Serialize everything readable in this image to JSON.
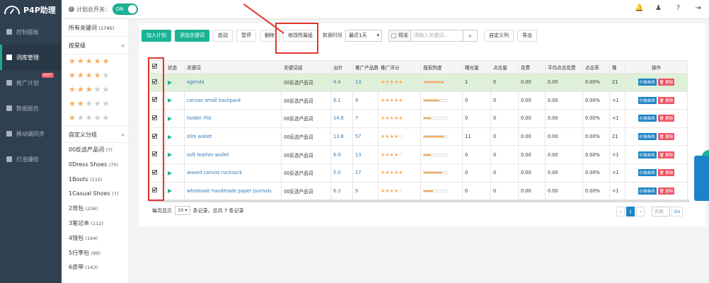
{
  "brand": {
    "name": "P4P助理"
  },
  "plan_switch": {
    "label": "计划总开关：",
    "state": "ON"
  },
  "top_icons": [
    "bell-icon",
    "user-icon",
    "help-icon",
    "logout-icon"
  ],
  "sidebar": {
    "items": [
      {
        "label": "控制面板",
        "icon": "home-icon"
      },
      {
        "label": "词库管理",
        "icon": "monitor-icon",
        "active": true
      },
      {
        "label": "推广计划",
        "icon": "tag-icon",
        "badge": "HOT"
      },
      {
        "label": "数据报告",
        "icon": "chart-icon"
      },
      {
        "label": "移动端同步",
        "icon": "mobile-icon"
      },
      {
        "label": "打造爆款",
        "icon": "card-icon"
      }
    ]
  },
  "groups": {
    "all_label": "所有关键词",
    "all_count": "(1745)",
    "by_stars_label": "按星级",
    "star_levels": [
      5,
      4,
      3,
      2,
      1
    ],
    "custom_label": "自定义分组",
    "items": [
      {
        "name": "00反选产品词",
        "count": "(7)"
      },
      {
        "name": "0Dress Shoes",
        "count": "(70)"
      },
      {
        "name": "1Boots",
        "count": "(115)"
      },
      {
        "name": "1Casual Shoes",
        "count": "(7)"
      },
      {
        "name": "2背包",
        "count": "(236)"
      },
      {
        "name": "3笔记本",
        "count": "(112)"
      },
      {
        "name": "4钱包",
        "count": "(164)"
      },
      {
        "name": "5行李包",
        "count": "(99)"
      },
      {
        "name": "6皮带",
        "count": "(143)"
      }
    ]
  },
  "toolbar": {
    "add_plan": "加入计划",
    "add_keyword": "添加关键词",
    "start": "启动",
    "pause": "暂停",
    "delete": "删除",
    "modify_group": "修改所属组",
    "data_period_label": "数据时段",
    "data_period_value": "最近1天",
    "exact_label": "精准",
    "search_placeholder": "请输入关键词...",
    "custom_columns": "自定义列",
    "export": "导出"
  },
  "table": {
    "headers": [
      "",
      "状态",
      "关键词",
      "关键词组",
      "出价",
      "推广产品数",
      "推广评分",
      "搜索热度",
      "曝光量",
      "点击量",
      "花费",
      "平均点击花费",
      "点击率",
      "推",
      "操作"
    ],
    "rows": [
      {
        "keyword": "agenda",
        "group": "00反选产品词",
        "bid": "4.4",
        "products": "13",
        "rating": 5,
        "heat": 0.9,
        "impr": "1",
        "clicks": "0",
        "cost": "0.00",
        "cpc": "0.00",
        "ctr": "0.00%",
        "rank": "21",
        "highlight": true
      },
      {
        "keyword": "canvas small backpack",
        "group": "00反选产品词",
        "bid": "8.1",
        "products": "8",
        "rating": 5,
        "heat": 0.7,
        "impr": "0",
        "clicks": "0",
        "cost": "0.00",
        "cpc": "0.00",
        "ctr": "0.00%",
        "rank": "<1"
      },
      {
        "keyword": "holder rfid",
        "group": "00反选产品词",
        "bid": "14.6",
        "products": "7",
        "rating": 5,
        "heat": 0.3,
        "impr": "0",
        "clicks": "0",
        "cost": "0.00",
        "cpc": "0.00",
        "ctr": "0.00%",
        "rank": "<1"
      },
      {
        "keyword": "slim wallet",
        "group": "00反选产品词",
        "bid": "13.8",
        "products": "57",
        "rating": 4,
        "heat": 0.9,
        "impr": "11",
        "clicks": "0",
        "cost": "0.00",
        "cpc": "0.00",
        "ctr": "0.00%",
        "rank": "21"
      },
      {
        "keyword": "soft leather wallet",
        "group": "00反选产品词",
        "bid": "6.9",
        "products": "13",
        "rating": 4,
        "heat": 0.3,
        "impr": "0",
        "clicks": "0",
        "cost": "0.00",
        "cpc": "0.00",
        "ctr": "0.00%",
        "rank": "<1"
      },
      {
        "keyword": "waxed canvas rucksack",
        "group": "00反选产品词",
        "bid": "5.0",
        "products": "17",
        "rating": 5,
        "heat": 0.8,
        "impr": "0",
        "clicks": "0",
        "cost": "0.00",
        "cpc": "0.00",
        "ctr": "0.00%",
        "rank": "<1"
      },
      {
        "keyword": "wholesale handmade paper journals",
        "group": "00反选产品词",
        "bid": "6.3",
        "products": "9",
        "rating": 4,
        "heat": 0.4,
        "impr": "0",
        "clicks": "0",
        "cost": "0.00",
        "cpc": "0.00",
        "ctr": "0.00%",
        "rank": "<1"
      }
    ],
    "actions": {
      "curve": "价格曲线",
      "delete": "删除"
    }
  },
  "footer": {
    "per_page_label": "每页显示",
    "per_page_value": "10",
    "summary": "条记录，总共 7 条记录"
  },
  "pager": {
    "prev": "‹",
    "current": "1",
    "next": "›",
    "page_placeholder": "页数",
    "go": "Go"
  },
  "colors": {
    "sidebar": "#2f4050",
    "primary": "#1ab394",
    "blue": "#1c84c6",
    "red": "#ed5565",
    "highlight_row": "#dff0d8",
    "annotation": "#e0362f"
  }
}
